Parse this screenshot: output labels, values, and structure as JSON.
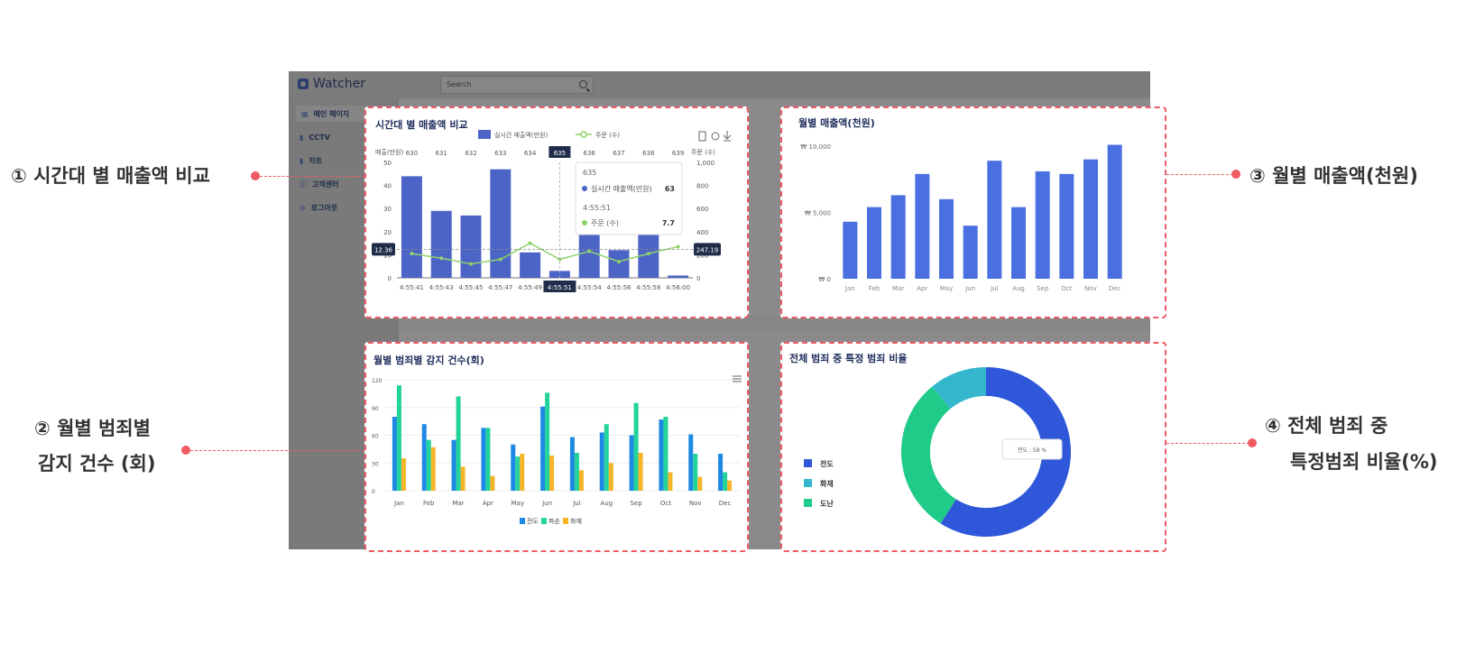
{
  "app": {
    "brand": "Watcher",
    "search_placeholder": "Search",
    "sidebar": [
      {
        "label": "메인 페이지",
        "icon": "grid-icon",
        "active": true
      },
      {
        "label": "CCTV",
        "icon": "bar-chart-icon",
        "active": false
      },
      {
        "label": "차트",
        "icon": "bar-chart-icon",
        "active": false
      },
      {
        "label": "고객센터",
        "icon": "question-circle-icon",
        "active": false
      },
      {
        "label": "로그아웃",
        "icon": "logout-icon",
        "active": false
      }
    ]
  },
  "callouts": {
    "c1": "① 시간대 별 매출액 비교",
    "c2_line1": "② 월별 범죄별",
    "c2_line2": "감지 건수 (회)",
    "c3": "③ 월별 매출액(천원)",
    "c4_line1": "④ 전체 범죄 중",
    "c4_line2": "특정범죄 비율(%)"
  },
  "colors": {
    "accent": "#ef5a63",
    "bar_blue": "#4d64c7",
    "line_green": "#8fd36a",
    "blue": "#1e88e5",
    "green": "#22d39b",
    "orange": "#f7b529",
    "donut_blue": "#2f57d9",
    "donut_cyan": "#34b7cc",
    "donut_green": "#1fcb88"
  },
  "chart_data": [
    {
      "id": "hourly",
      "type": "bar",
      "title": "시간대 별 매출액 비교",
      "legend": [
        "실시간 매출액(만원)",
        "주문 (수)"
      ],
      "y_left_label": "매출(만원)",
      "y_right_label": "주문 (수)",
      "categories": [
        "4:55:41",
        "4:55:43",
        "4:55:45",
        "4:55:47",
        "4:55:49",
        "4:55:51",
        "4:55:54",
        "4:55:56",
        "4:55:58",
        "4:56:00"
      ],
      "top_labels": [
        "630",
        "631",
        "632",
        "633",
        "634",
        "635",
        "636",
        "637",
        "638",
        "639"
      ],
      "ylim_left": [
        0,
        50
      ],
      "y_left_ticks": [
        "0",
        "10",
        "20",
        "30",
        "40",
        "50"
      ],
      "ylim_right": [
        0,
        1000
      ],
      "y_right_ticks": [
        "0",
        "200",
        "400",
        "600",
        "800",
        "1,000"
      ],
      "series": [
        {
          "name": "실시간 매출액(만원)",
          "type": "bar",
          "values": [
            44,
            29,
            27,
            47,
            11,
            3,
            19,
            12,
            19,
            1
          ]
        },
        {
          "name": "주문 (수)",
          "type": "line",
          "values": [
            210,
            170,
            120,
            160,
            300,
            160,
            230,
            140,
            210,
            270
          ]
        }
      ],
      "crosshair_left": "12.36",
      "crosshair_right": "247.19",
      "highlight_index": 5,
      "tooltip": {
        "header1": "635",
        "row1_label": "실시간 매출액(만원)",
        "row1_value": "63",
        "header2": "4:55:51",
        "row2_label": "주문 (수)",
        "row2_value": "7.7"
      }
    },
    {
      "id": "monthly-sales",
      "type": "bar",
      "title": "월별 매출액(천원)",
      "categories": [
        "Jan",
        "Feb",
        "Mar",
        "Apr",
        "May",
        "Jun",
        "Jul",
        "Aug",
        "Sep",
        "Oct",
        "Nov",
        "Dec"
      ],
      "values": [
        4300,
        5400,
        6300,
        7900,
        6000,
        4000,
        8900,
        5400,
        8100,
        7900,
        9000,
        10100
      ],
      "ylim": [
        0,
        10000
      ],
      "y_ticks": [
        "₩ 0",
        "₩ 5,000",
        "₩ 10,000"
      ]
    },
    {
      "id": "monthly-crime",
      "type": "bar",
      "title": "월별 범죄별 감지 건수(회)",
      "categories": [
        "Jan",
        "Feb",
        "Mar",
        "Apr",
        "May",
        "Jun",
        "Jul",
        "Aug",
        "Sep",
        "Oct",
        "Nov",
        "Dec"
      ],
      "ylim": [
        0,
        120
      ],
      "y_ticks": [
        "0",
        "30",
        "60",
        "90",
        "120"
      ],
      "series": [
        {
          "name": "전도",
          "values": [
            80,
            72,
            55,
            68,
            50,
            91,
            58,
            63,
            60,
            77,
            61,
            40
          ]
        },
        {
          "name": "파손",
          "values": [
            114,
            55,
            102,
            68,
            37,
            106,
            41,
            72,
            95,
            80,
            40,
            20
          ]
        },
        {
          "name": "화재",
          "values": [
            35,
            47,
            26,
            16,
            40,
            38,
            22,
            30,
            41,
            20,
            15,
            11
          ]
        }
      ],
      "legend": [
        "전도",
        "파손",
        "화재"
      ]
    },
    {
      "id": "crime-ratio",
      "type": "pie",
      "title": "전체 범죄 중 특정 범죄 비율",
      "labels": [
        "전도",
        "화재",
        "도난"
      ],
      "values": [
        59,
        11,
        30
      ],
      "tooltip": "전도 : 59 %"
    }
  ]
}
